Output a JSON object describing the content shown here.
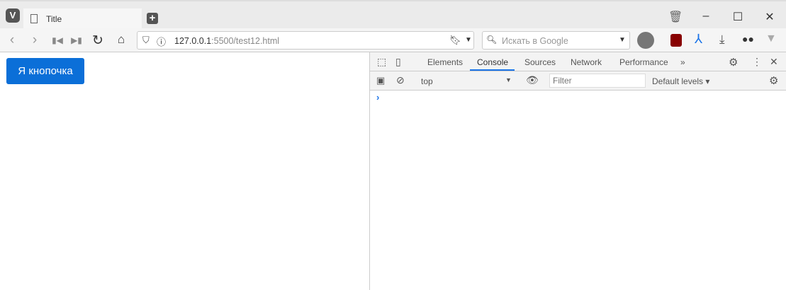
{
  "browser": {
    "tab_title": "Title",
    "url_host": "127.0.0.1",
    "url_rest": ":5500/test12.html",
    "search_placeholder": "Искать в Google"
  },
  "page": {
    "button_label": "Я кнопочка"
  },
  "devtools": {
    "tabs": [
      "Elements",
      "Console",
      "Sources",
      "Network",
      "Performance"
    ],
    "active_tab": "Console",
    "context": "top",
    "filter_placeholder": "Filter",
    "levels": "Default levels ▾",
    "prompt": "›"
  }
}
